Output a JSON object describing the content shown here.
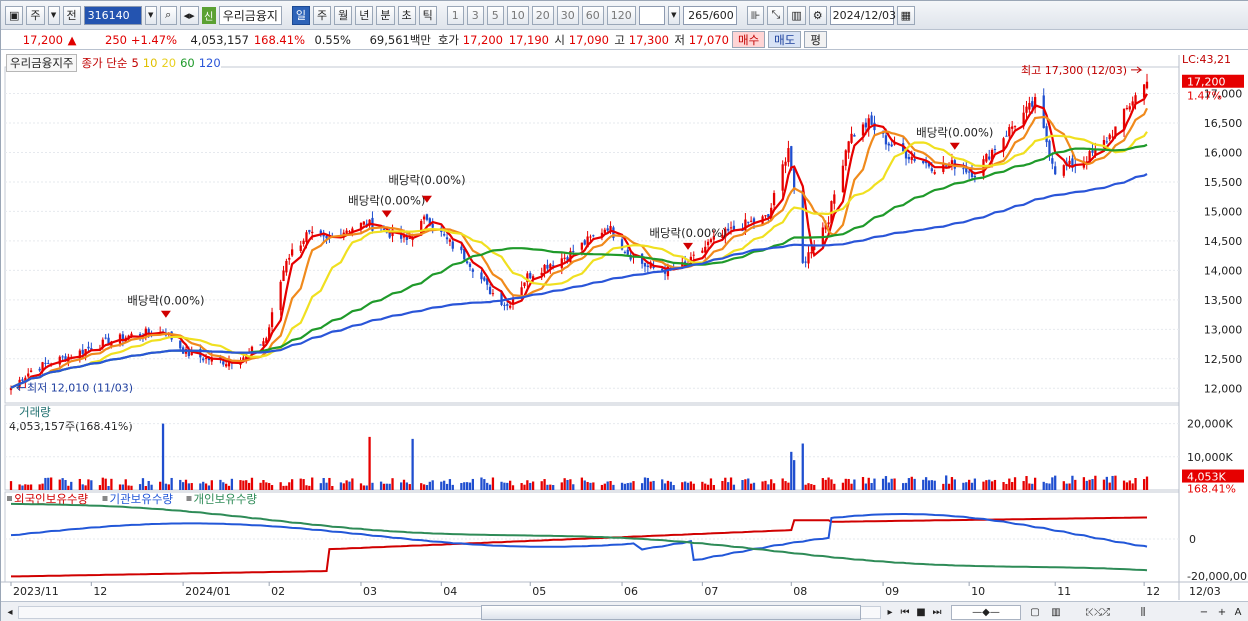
{
  "toolbar": {
    "market_label": "주",
    "type_label": "전",
    "code": "316140",
    "name": "우리금융지",
    "sin_badge": "신",
    "periods": [
      "일",
      "주",
      "월",
      "년",
      "분",
      "초",
      "틱"
    ],
    "active_period": "일",
    "intervals": [
      "1",
      "3",
      "5",
      "10",
      "20",
      "30",
      "60",
      "120"
    ],
    "count_value": "265",
    "count_max": "/600",
    "date": "2024/12/03"
  },
  "quote": {
    "price": "17,200",
    "arrow": "▲",
    "change": "250",
    "change_pct": "+1.47%",
    "volume": "4,053,157",
    "volume_ratio": "168.41%",
    "turnover_pct": "0.55%",
    "amount": "69,561백만",
    "ask_label": "호가",
    "ask": "17,200",
    "bid": "17,190",
    "open_label": "시",
    "open": "17,090",
    "high_label": "고",
    "high": "17,300",
    "low_label": "저",
    "low": "17,070",
    "buy_btn": "매수",
    "sell_btn": "매도",
    "eval_btn": "평"
  },
  "legend": {
    "name": "우리금융지주",
    "ma_label": "종가 단순",
    "ma_periods": [
      "5",
      "10",
      "20",
      "60",
      "120"
    ],
    "lc_label": "LC:43,21"
  },
  "colors": {
    "up": "#e60000",
    "down": "#1f4ecf",
    "ma5": "#e60000",
    "ma10": "#f08a1c",
    "ma20": "#f0e020",
    "ma60": "#1f9a2a",
    "ma120": "#2a55d8",
    "foreign": "#d00000",
    "institution": "#2257d8",
    "individual": "#2e8b57"
  },
  "price_axis": [
    "17,000",
    "16,500",
    "16,000",
    "15,500",
    "15,000",
    "14,500",
    "14,000",
    "13,500",
    "13,000",
    "12,500",
    "12,000"
  ],
  "price_tags": {
    "current": "17,200",
    "pct": "1.47%"
  },
  "annotations": {
    "high": "최고 17,300 (12/03)",
    "low": "최저 12,010 (11/03)",
    "dividends": [
      "배당락(0.00%)",
      "배당락(0.00%)",
      "배당락(0.00%)",
      "배당락(0.00%)",
      "배당락(0.00%)"
    ]
  },
  "volume_panel": {
    "title": "거래량",
    "value": "4,053,157주(168.41%)",
    "axis": [
      "20,000K",
      "10,000K"
    ],
    "tag_value": "4,053K",
    "tag_pct": "168.41%"
  },
  "holdings_panel": {
    "series": [
      "외국인보유수량",
      "기관보유수량",
      "개인보유수량"
    ],
    "axis": [
      "0",
      "-20,000,00"
    ]
  },
  "x_axis": [
    "2023/11",
    "12",
    "2024/01",
    "02",
    "03",
    "04",
    "05",
    "06",
    "07",
    "08",
    "09",
    "10",
    "11",
    "12",
    "12/03"
  ],
  "chart_data": {
    "type": "candlestick",
    "title": "우리금융지주",
    "x_labels": [
      "2023/11",
      "12",
      "2024/01",
      "02",
      "03",
      "04",
      "05",
      "06",
      "07",
      "08",
      "09",
      "10",
      "11",
      "12"
    ],
    "ylim": [
      11750,
      17450
    ],
    "close_path": [
      [
        "2023-11-03",
        12010
      ],
      [
        "2023-11-10",
        12300
      ],
      [
        "2023-11-17",
        12450
      ],
      [
        "2023-11-24",
        12550
      ],
      [
        "2023-12-01",
        12700
      ],
      [
        "2023-12-08",
        12800
      ],
      [
        "2023-12-15",
        12900
      ],
      [
        "2023-12-22",
        12950
      ],
      [
        "2023-12-27",
        12950
      ],
      [
        "2024-01-03",
        12600
      ],
      [
        "2024-01-10",
        12500
      ],
      [
        "2024-01-17",
        12450
      ],
      [
        "2024-01-24",
        12550
      ],
      [
        "2024-01-31",
        12850
      ],
      [
        "2024-02-07",
        14200
      ],
      [
        "2024-02-14",
        14600
      ],
      [
        "2024-02-21",
        14500
      ],
      [
        "2024-02-28",
        14700
      ],
      [
        "2024-03-06",
        14800
      ],
      [
        "2024-03-13",
        14650
      ],
      [
        "2024-03-20",
        14500
      ],
      [
        "2024-03-27",
        14900
      ],
      [
        "2024-04-03",
        14500
      ],
      [
        "2024-04-10",
        14200
      ],
      [
        "2024-04-17",
        13700
      ],
      [
        "2024-04-24",
        13400
      ],
      [
        "2024-05-01",
        13900
      ],
      [
        "2024-05-08",
        14100
      ],
      [
        "2024-05-15",
        14250
      ],
      [
        "2024-05-22",
        14500
      ],
      [
        "2024-05-29",
        14750
      ],
      [
        "2024-06-05",
        14300
      ],
      [
        "2024-06-12",
        14050
      ],
      [
        "2024-06-19",
        14000
      ],
      [
        "2024-06-26",
        14100
      ],
      [
        "2024-07-03",
        14450
      ],
      [
        "2024-07-10",
        14650
      ],
      [
        "2024-07-17",
        14800
      ],
      [
        "2024-07-24",
        14900
      ],
      [
        "2024-07-31",
        16100
      ],
      [
        "2024-08-05",
        14100
      ],
      [
        "2024-08-14",
        14900
      ],
      [
        "2024-08-21",
        16250
      ],
      [
        "2024-08-28",
        16500
      ],
      [
        "2024-09-04",
        16150
      ],
      [
        "2024-09-11",
        15950
      ],
      [
        "2024-09-20",
        15750
      ],
      [
        "2024-09-27",
        15800
      ],
      [
        "2024-10-04",
        15650
      ],
      [
        "2024-10-11",
        16100
      ],
      [
        "2024-10-18",
        16500
      ],
      [
        "2024-10-25",
        16850
      ],
      [
        "2024-11-01",
        15700
      ],
      [
        "2024-11-08",
        15800
      ],
      [
        "2024-11-15",
        16000
      ],
      [
        "2024-11-22",
        16400
      ],
      [
        "2024-11-28",
        16900
      ],
      [
        "2024-12-03",
        17200
      ]
    ],
    "volume_max_k": 20000,
    "volume_current_k": 4053,
    "holdings_series": [
      "외국인보유수량",
      "기관보유수량",
      "개인보유수량"
    ],
    "holdings_axis": [
      "0",
      "-20,000,00"
    ],
    "moving_averages": [
      "5",
      "10",
      "20",
      "60",
      "120"
    ]
  }
}
